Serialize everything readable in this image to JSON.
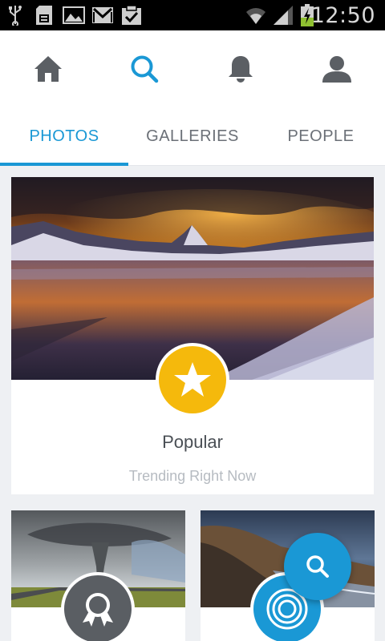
{
  "status_bar": {
    "time": "12:50",
    "icons": [
      "usb-icon",
      "sd-card-icon",
      "image-icon",
      "gmail-icon",
      "clipboard-check-icon",
      "wifi-icon",
      "signal-icon",
      "battery-charging-icon"
    ]
  },
  "nav": {
    "items": [
      "home-icon",
      "search-icon",
      "bell-icon",
      "profile-icon"
    ],
    "active": "search-icon"
  },
  "tabs": [
    {
      "label": "PHOTOS",
      "active": true
    },
    {
      "label": "GALLERIES",
      "active": false
    },
    {
      "label": "PEOPLE",
      "active": false
    }
  ],
  "featured": {
    "title": "Popular",
    "subtitle": "Trending Right Now",
    "badge_icon": "star-icon",
    "badge_color": "#f5b90c"
  },
  "categories": [
    {
      "badge_icon": "award-ribbon-icon",
      "badge_color": "#5a5e63"
    },
    {
      "badge_icon": "concentric-circles-icon",
      "badge_color": "#1a98d5"
    }
  ],
  "fab": {
    "icon": "search-icon",
    "color": "#1a98d5"
  },
  "colors": {
    "accent": "#1a98d5",
    "tab_inactive": "#6b7077",
    "background": "#eef0f3"
  }
}
